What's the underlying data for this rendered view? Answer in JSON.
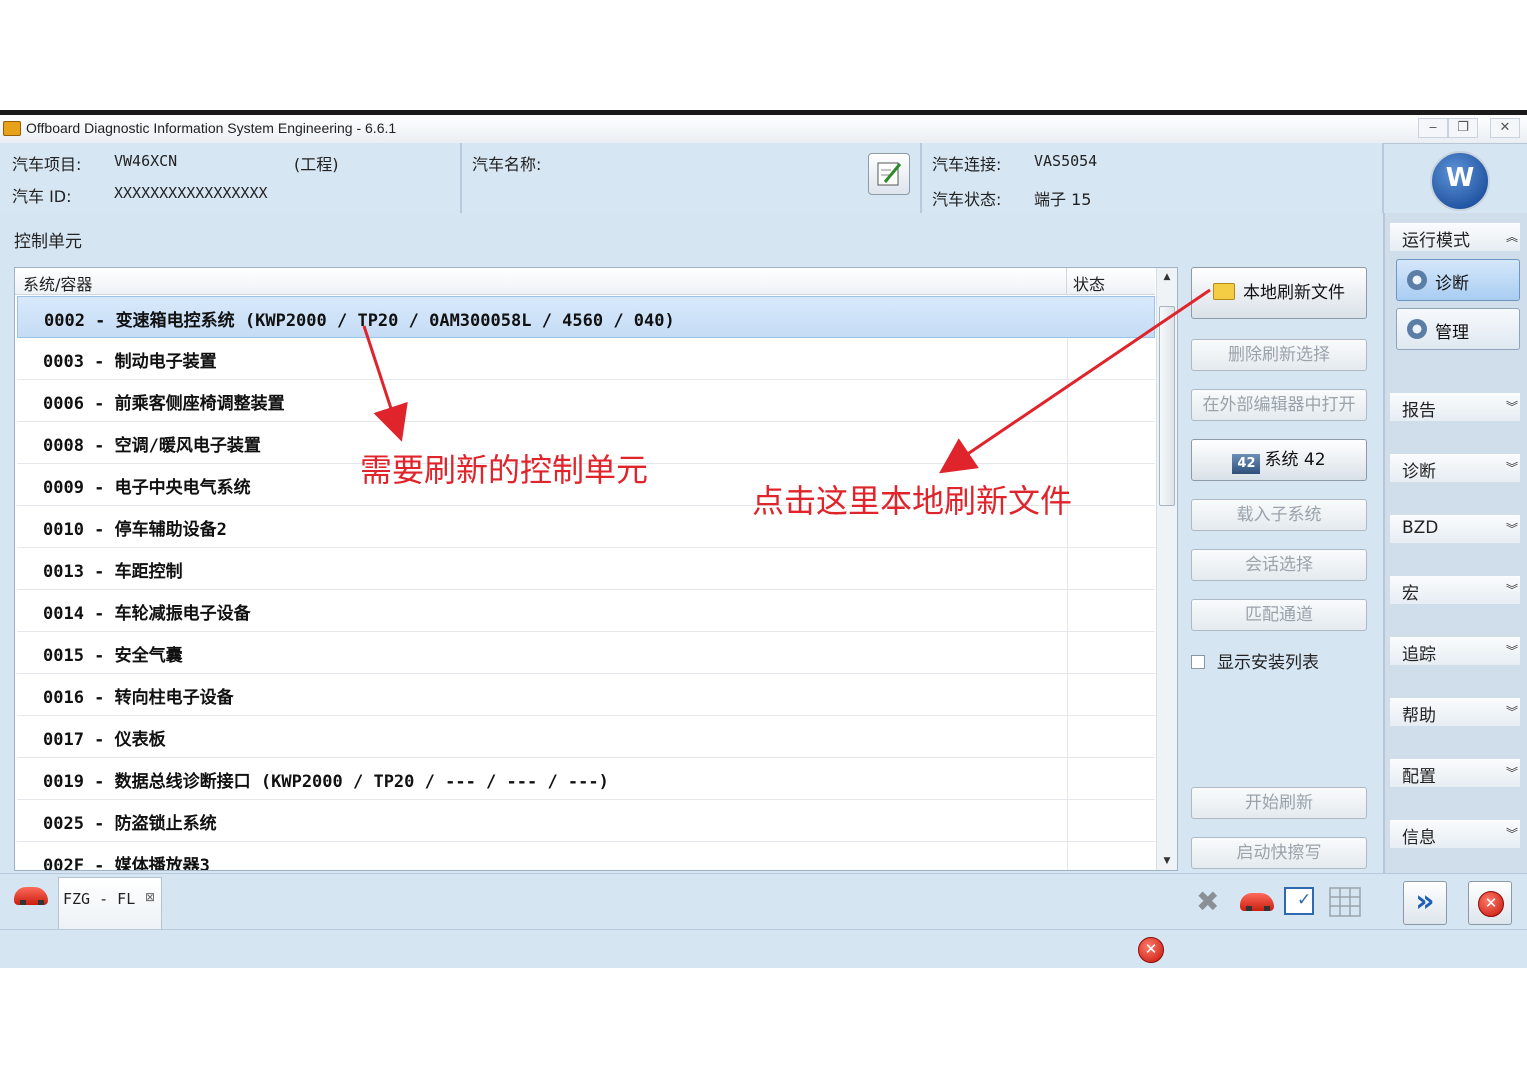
{
  "window": {
    "title": "Offboard Diagnostic Information System Engineering - 6.6.1"
  },
  "header": {
    "project_label": "汽车项目:",
    "project_value": "VW46XCN",
    "project_mode": "(工程)",
    "id_label": "汽车 ID:",
    "id_value": "XXXXXXXXXXXXXXXXX",
    "name_label": "汽车名称:",
    "connection_label": "汽车连接:",
    "connection_value": "VAS5054",
    "state_label": "汽车状态:",
    "state_value": "端子 15"
  },
  "section_title": "控制单元",
  "table": {
    "col_system": "系统/容器",
    "col_status": "状态",
    "rows": [
      "0002 - 变速箱电控系统  (KWP2000 / TP20 / 0AM300058L / 4560 / 040)",
      "0003 - 制动电子装置",
      "0006 - 前乘客侧座椅调整装置",
      "0008 - 空调/暖风电子装置",
      "0009 - 电子中央电气系统",
      "0010 - 停车辅助设备2",
      "0013 - 车距控制",
      "0014 - 车轮减振电子设备",
      "0015 - 安全气囊",
      "0016 - 转向柱电子设备",
      "0017 - 仪表板",
      "0019 - 数据总线诊断接口  (KWP2000 / TP20 / --- / --- / ---)",
      "0025 - 防盗锁止系统",
      "002F - 媒体播放器3"
    ]
  },
  "actions": {
    "local_flash_file": "本地刷新文件",
    "delete_flash_selection": "删除刷新选择",
    "open_external_editor": "在外部编辑器中打开",
    "system_badge": "42",
    "system_label": "系统 42",
    "load_subsystem": "载入子系统",
    "session_select": "会话选择",
    "match_channel": "匹配通道",
    "show_install_list": "显示安装列表",
    "start_flash": "开始刷新",
    "start_quick_erase": "启动快擦写"
  },
  "sidebar": {
    "run_mode": "运行模式",
    "diagnose_btn": "诊断",
    "manage_btn": "管理",
    "items": [
      "报告",
      "诊断",
      "BZD",
      "宏",
      "追踪",
      "帮助",
      "配置",
      "信息"
    ]
  },
  "bottom": {
    "tab_label": "FZG - FL"
  },
  "annotations": {
    "control_unit_note": "需要刷新的控制单元",
    "click_here_note": "点击这里本地刷新文件"
  },
  "colors": {
    "annotation": "#e0242b",
    "selected_row": "#c5dcf5"
  }
}
